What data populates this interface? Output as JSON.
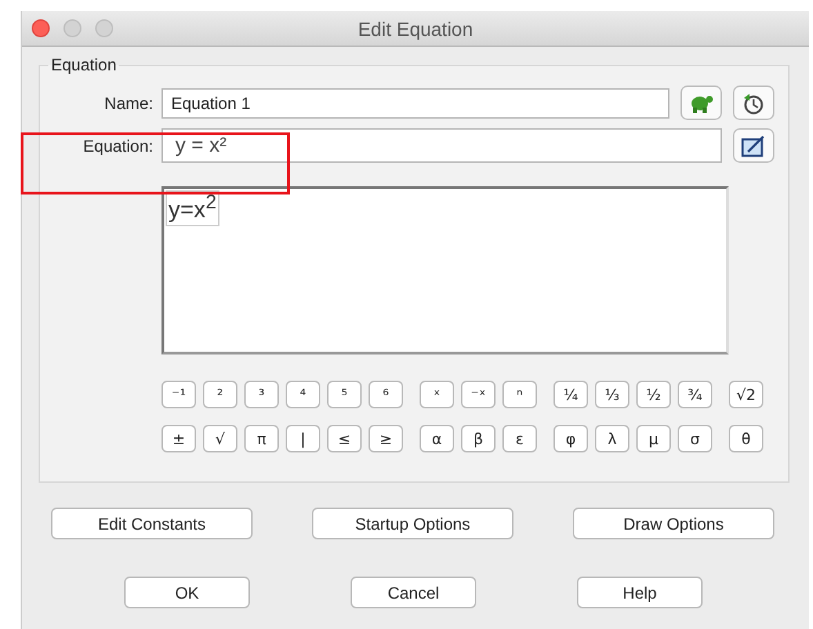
{
  "window": {
    "title": "Edit Equation"
  },
  "group": {
    "title": "Equation"
  },
  "name_field": {
    "label": "Name:",
    "value": "Equation 1"
  },
  "equation_field": {
    "label": "Equation:",
    "value": "y = x²"
  },
  "preview": {
    "text": "y=x$^{2}$"
  },
  "keypad": [
    [
      [
        "⁻¹",
        "²",
        "³",
        "⁴",
        "⁵",
        "⁶"
      ],
      [
        "ˣ",
        "⁻ˣ",
        "ⁿ"
      ],
      [
        "¼",
        "⅓",
        "½",
        "¾"
      ],
      [
        "√2"
      ]
    ],
    [
      [
        "±",
        "√",
        "π",
        "|",
        "≤",
        "≥"
      ],
      [
        "α",
        "β",
        "ε"
      ],
      [
        "φ",
        "λ",
        "μ",
        "σ"
      ],
      [
        "θ"
      ]
    ]
  ],
  "option_buttons": [
    "Edit Constants",
    "Startup Options",
    "Draw Options"
  ],
  "dialog_buttons": [
    "OK",
    "Cancel",
    "Help"
  ]
}
